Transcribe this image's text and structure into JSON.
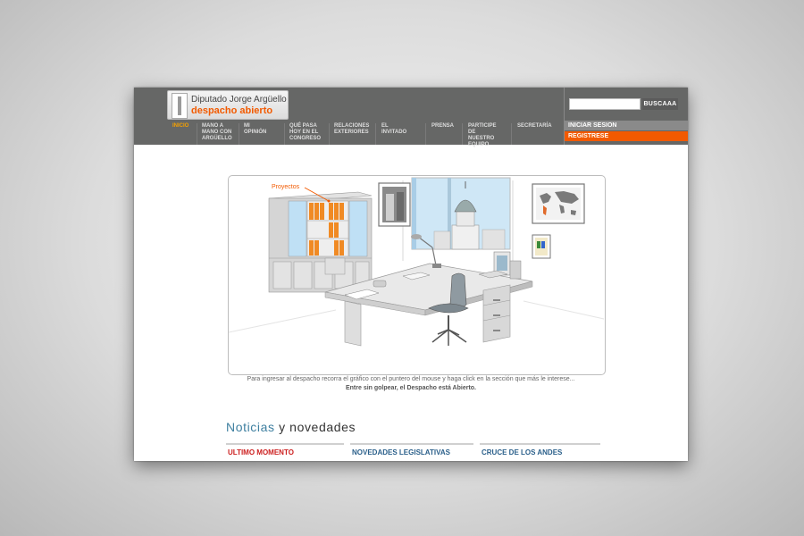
{
  "header": {
    "logo": {
      "line1": "Diputado Jorge Argüello",
      "line2": "despacho abierto"
    },
    "search_button": "BUSCAAA",
    "search_placeholder": "",
    "login": "INICIAR SESION",
    "register": "REGISTRESE"
  },
  "nav": [
    {
      "label": "INICIO",
      "active": true
    },
    {
      "label": "MANO A\nMANO CON\nARGÜELLO",
      "active": false
    },
    {
      "label": "MI OPINIÓN",
      "active": false
    },
    {
      "label": "QUÉ PASA\nHOY EN EL\nCONGRESO",
      "active": false
    },
    {
      "label": "RELACIONES\nEXTERIORES",
      "active": false
    },
    {
      "label": "EL INVITADO",
      "active": false
    },
    {
      "label": "PRENSA",
      "active": false
    },
    {
      "label": "PARTICIPE\nDE NUESTRO\nEQUIPO",
      "active": false
    },
    {
      "label": "SECRETARÍA",
      "active": false
    }
  ],
  "illustration": {
    "label_proyectos": "Proyectos"
  },
  "caption": {
    "line1": "Para ingresar al despacho recorra el gráfico con el puntero del mouse y haga click en la sección que más le interese...",
    "line2": "Entre sin golpear, el Despacho está Abierto."
  },
  "news": {
    "title_part1": "Noticias",
    "title_part2": "y novedades",
    "columns": [
      "ULTIMO MOMENTO",
      "NOVEDADES LEGISLATIVAS",
      "CRUCE DE LOS ANDES"
    ]
  },
  "colors": {
    "accent": "#f25a00",
    "header_bg": "#666766",
    "news_blue": "#3e7fa0",
    "alert_red": "#cc1f1f"
  }
}
